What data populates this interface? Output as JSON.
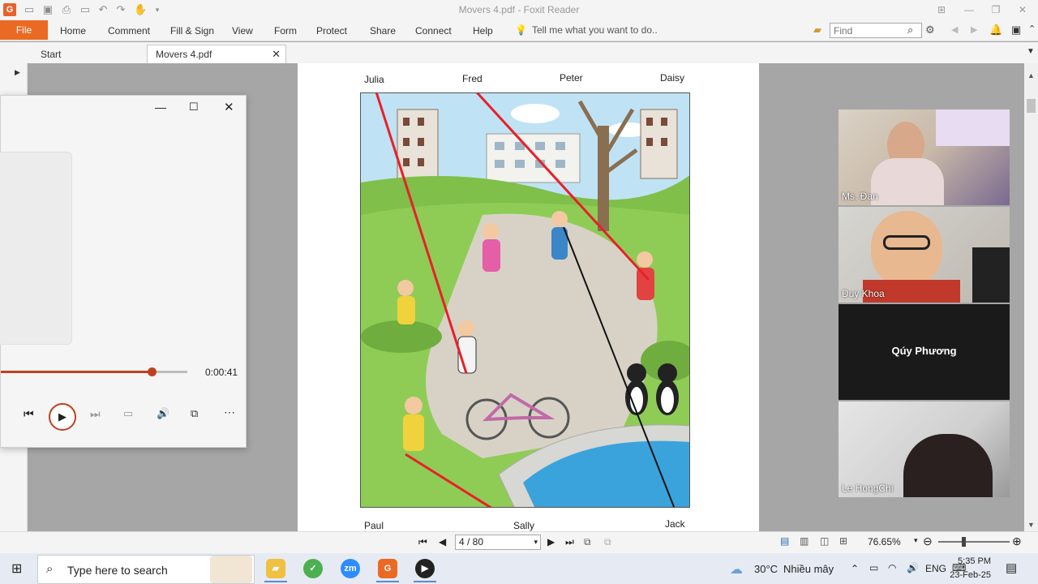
{
  "window": {
    "title": "Movers 4.pdf - Foxit Reader",
    "app_logo": "G"
  },
  "ribbon": {
    "file": "File",
    "menus": [
      "Home",
      "Comment",
      "Fill & Sign",
      "View",
      "Form",
      "Protect",
      "Share",
      "Connect",
      "Help"
    ],
    "tell_me": "Tell me what you want to do..",
    "find_placeholder": "Find"
  },
  "tabs": {
    "start": "Start",
    "document": "Movers 4.pdf"
  },
  "page": {
    "top_names": [
      "Julia",
      "Fred",
      "Peter",
      "Daisy"
    ],
    "bottom_names": [
      "Paul",
      "Sally",
      "Jack"
    ]
  },
  "player": {
    "time": "0:00:41",
    "progress": 0.81
  },
  "participants": [
    {
      "name": "Ms. Đan",
      "video": true
    },
    {
      "name": "Duy Khoa",
      "video": true
    },
    {
      "name": "Qúy Phương",
      "video": false
    },
    {
      "name": "Le HongChi",
      "video": true
    }
  ],
  "statusbar": {
    "page_value": "4 / 80",
    "zoom": "76.65%"
  },
  "taskbar": {
    "search_placeholder": "Type here to search",
    "weather_temp": "30°C",
    "weather_desc": "Nhiều mây",
    "language": "ENG",
    "time": "5:35 PM",
    "date": "23-Feb-25"
  },
  "colors": {
    "accent": "#ea6a24",
    "answer_line_red": "#e8202a",
    "answer_line_black": "#111111"
  }
}
